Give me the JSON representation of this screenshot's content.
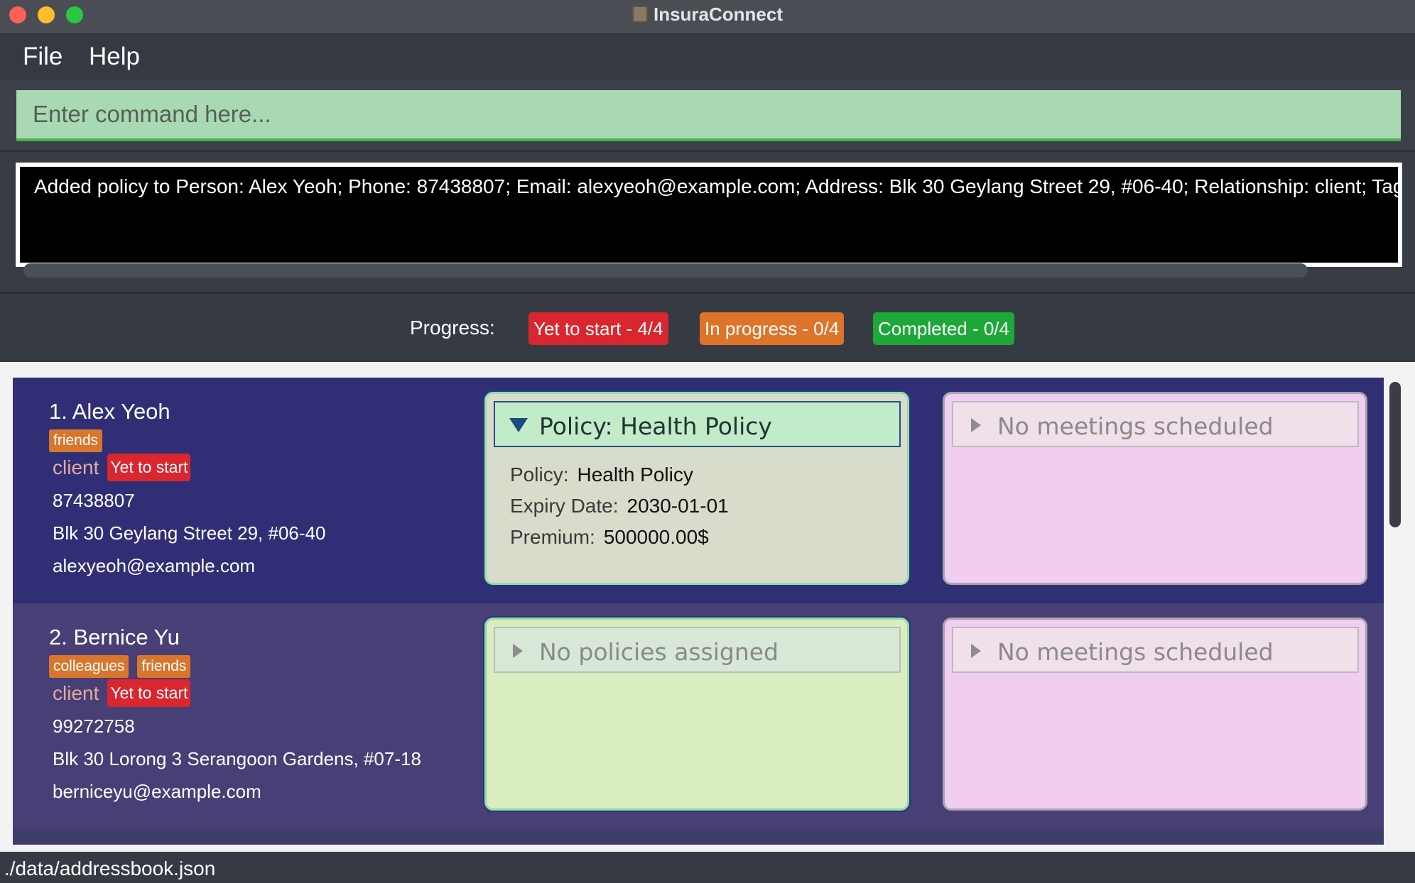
{
  "window": {
    "title": "InsuraConnect"
  },
  "menu": {
    "file": "File",
    "help": "Help"
  },
  "command": {
    "placeholder": "Enter command here..."
  },
  "result": {
    "text": "Added policy to Person: Alex Yeoh; Phone: 87438807; Email: alexyeoh@example.com; Address: Blk 30 Geylang Street 29, #06-40; Relationship: client; Tags:"
  },
  "progress": {
    "label": "Progress:",
    "yet_to_start": "Yet to start - 4/4",
    "in_progress": "In progress - 0/4",
    "completed": "Completed - 0/4"
  },
  "persons": [
    {
      "name": "1.  Alex Yeoh",
      "tags": [
        "friends"
      ],
      "relationship": "client",
      "status": "Yet to start",
      "phone": "87438807",
      "address": "Blk 30 Geylang Street 29, #06-40",
      "email": "alexyeoh@example.com",
      "policy": {
        "header": "Policy: Health Policy",
        "policy_label": "Policy:",
        "policy_value": "Health Policy",
        "expiry_label": "Expiry Date:",
        "expiry_value": "2030-01-01",
        "premium_label": "Premium:",
        "premium_value": "500000.00$"
      },
      "meetings": "No meetings scheduled"
    },
    {
      "name": "2.  Bernice Yu",
      "tags": [
        "colleagues",
        "friends"
      ],
      "relationship": "client",
      "status": "Yet to start",
      "phone": "99272758",
      "address": "Blk 30 Lorong 3 Serangoon Gardens, #07-18",
      "email": "berniceyu@example.com",
      "policies": "No policies assigned",
      "meetings": "No meetings scheduled"
    }
  ],
  "status_bar": {
    "path": "./data/addressbook.json"
  },
  "colors": {
    "command_bg": "#a9d9b2",
    "badge_red": "#d9262f",
    "badge_orange": "#dd7429",
    "badge_green": "#1ea83a",
    "card1_bg": "#302f75",
    "card2_bg": "#483f76",
    "policy_panel_bg": "#d9edbf",
    "meeting_panel_bg": "#f0cdf1"
  }
}
